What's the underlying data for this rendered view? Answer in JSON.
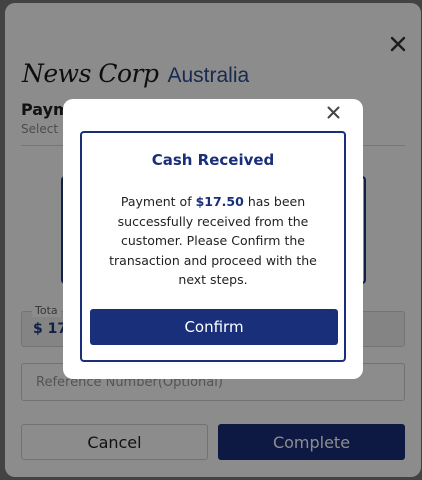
{
  "brand": {
    "logo_script": "News Corp",
    "logo_suffix": "Australia",
    "logo_suffix_color": "#2f4e92"
  },
  "payment": {
    "title_visible": "Paym",
    "subtitle_visible": "Select",
    "total_label_visible": "Tota",
    "total_value_visible": "$ 17.",
    "reference_placeholder": "Reference Number(Optional)",
    "cancel_label": "Cancel",
    "complete_label": "Complete"
  },
  "dialog": {
    "title": "Cash Received",
    "message_prefix": "Payment of",
    "amount": "$17.50",
    "message_suffix": "has been successfully received from the customer. Please Confirm the transaction and proceed with the next steps.",
    "confirm_label": "Confirm"
  },
  "icons": {
    "base_close": "close-icon",
    "dialog_close": "close-icon"
  },
  "colors": {
    "primary": "#1a2f7a",
    "overlay": "rgba(0,0,0,0.45)"
  }
}
